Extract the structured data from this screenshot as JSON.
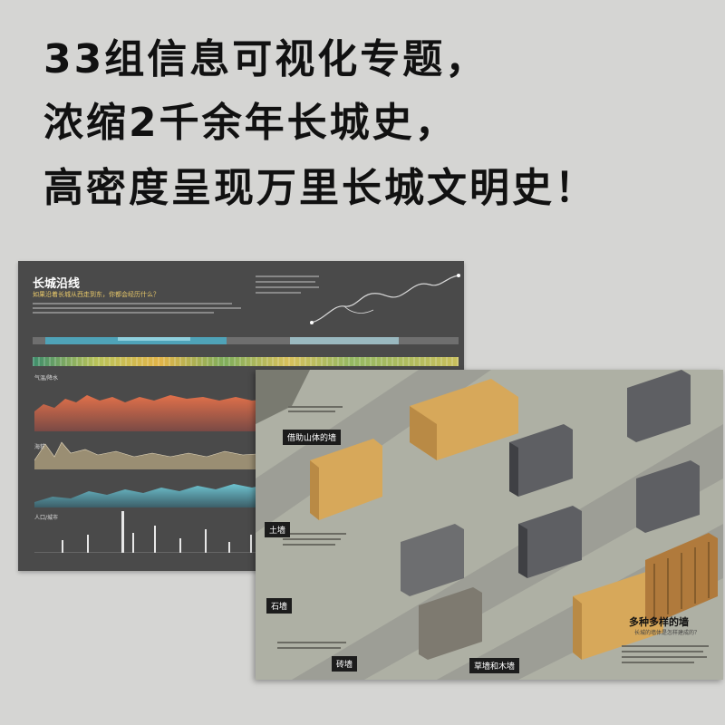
{
  "headline": {
    "line1": "33组信息可视化专题，",
    "line2": "浓缩2千余年长城史，",
    "line3": "高密度呈现万里长城文明史！"
  },
  "left_page": {
    "title": "长城沿线",
    "subtitle": "如果沿着长城从西走到东，你都会经历什么？",
    "section_labels": [
      "气温/降水",
      "海拔",
      "人口/城市"
    ]
  },
  "right_page": {
    "wall_labels": [
      "借助山体的墙",
      "土墙",
      "石墙",
      "砖墙",
      "草墙和木墙"
    ],
    "title": "多种多样的墙",
    "subtitle": "长城的墙体是怎样建成的？"
  },
  "colors": {
    "background": "#d5d5d3",
    "left_page": "#4a4a4a",
    "right_page": "#aeb0a4",
    "earth": "#d7a85a",
    "stone": "#5e5f63",
    "accent_label": "#1c1c1c"
  }
}
